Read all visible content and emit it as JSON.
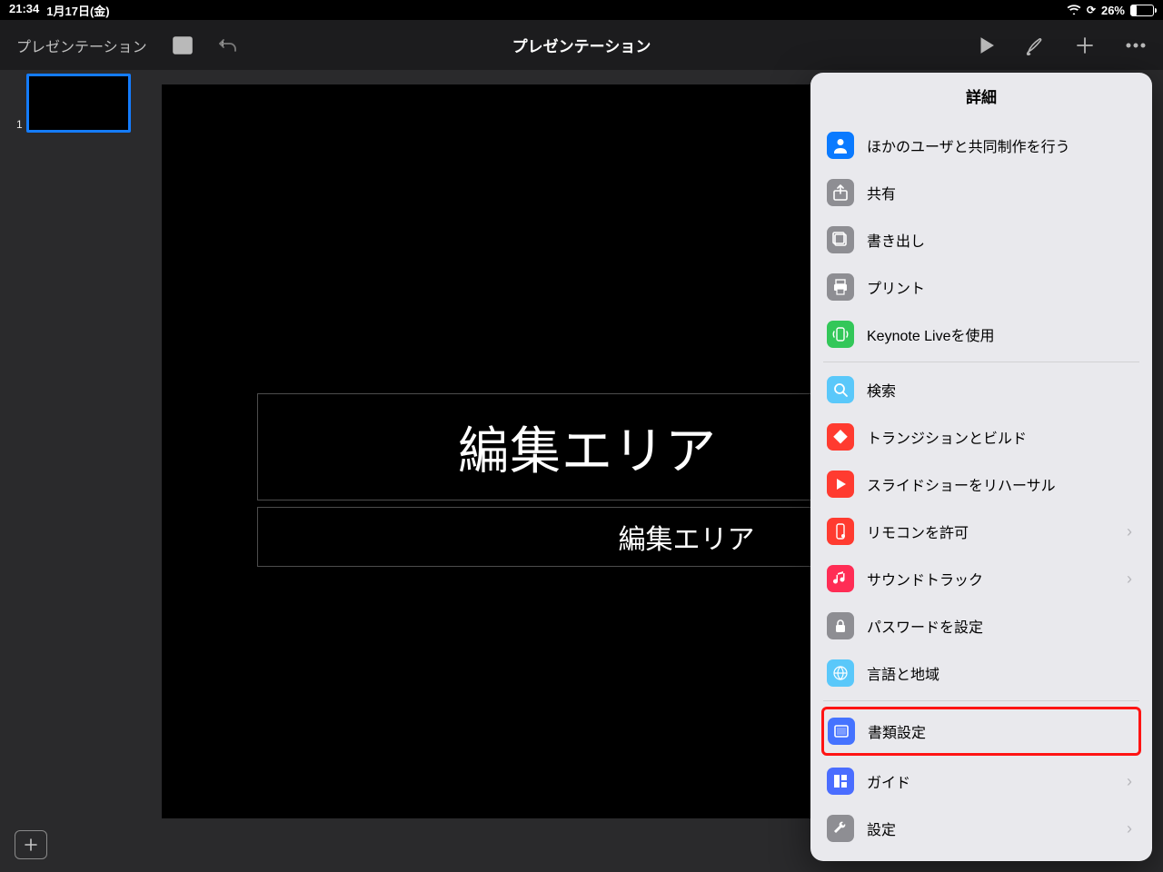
{
  "status": {
    "time": "21:34",
    "date": "1月17日(金)",
    "battery_pct": "26%",
    "battery_fill": 26
  },
  "toolbar": {
    "back_label": "プレゼンテーション",
    "title": "プレゼンテーション"
  },
  "nav": {
    "slide_number": "1"
  },
  "canvas": {
    "title_text": "編集エリア",
    "subtitle_text": "編集エリア"
  },
  "popover": {
    "header": "詳細",
    "groups": [
      [
        {
          "id": "collaborate",
          "icon": "person-icon",
          "color": "ic-blue",
          "label": "ほかのユーザと共同制作を行う",
          "chevron": false
        },
        {
          "id": "share",
          "icon": "share-icon",
          "color": "ic-gray",
          "label": "共有",
          "chevron": false
        },
        {
          "id": "export",
          "icon": "export-icon",
          "color": "ic-gray",
          "label": "書き出し",
          "chevron": false
        },
        {
          "id": "print",
          "icon": "print-icon",
          "color": "ic-gray",
          "label": "プリント",
          "chevron": false
        },
        {
          "id": "live",
          "icon": "broadcast-icon",
          "color": "ic-green",
          "label": "Keynote Liveを使用",
          "chevron": false
        }
      ],
      [
        {
          "id": "search",
          "icon": "search-icon",
          "color": "ic-lblue",
          "label": "検索",
          "chevron": false
        },
        {
          "id": "transitions",
          "icon": "diamond-icon",
          "color": "ic-red",
          "label": "トランジションとビルド",
          "chevron": false
        },
        {
          "id": "rehearse",
          "icon": "play-icon",
          "color": "ic-red",
          "label": "スライドショーをリハーサル",
          "chevron": false
        },
        {
          "id": "remote",
          "icon": "remote-icon",
          "color": "ic-red",
          "label": "リモコンを許可",
          "chevron": true
        },
        {
          "id": "soundtrack",
          "icon": "music-icon",
          "color": "ic-pink",
          "label": "サウンドトラック",
          "chevron": true
        },
        {
          "id": "password",
          "icon": "lock-icon",
          "color": "ic-gray",
          "label": "パスワードを設定",
          "chevron": false
        },
        {
          "id": "locale",
          "icon": "globe-icon",
          "color": "ic-lblue",
          "label": "言語と地域",
          "chevron": false
        }
      ],
      [
        {
          "id": "docsetup",
          "icon": "doc-icon",
          "color": "ic-blue2",
          "label": "書類設定",
          "chevron": false,
          "highlight": true
        },
        {
          "id": "guide",
          "icon": "guide-icon",
          "color": "ic-blue3",
          "label": "ガイド",
          "chevron": true
        },
        {
          "id": "settings",
          "icon": "wrench-icon",
          "color": "ic-gray",
          "label": "設定",
          "chevron": true
        }
      ]
    ]
  }
}
